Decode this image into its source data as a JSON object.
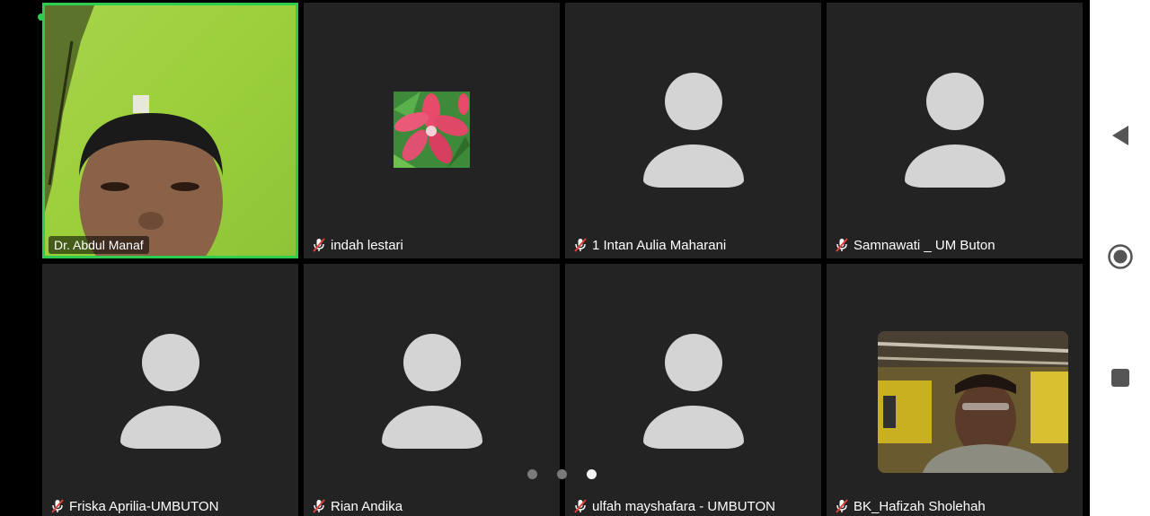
{
  "meeting": {
    "participants": [
      {
        "name": "Dr. Abdul Manaf",
        "muted": false,
        "video": true,
        "active_speaker": true
      },
      {
        "name": "indah lestari",
        "muted": true,
        "video": false,
        "avatar": "flower-image"
      },
      {
        "name": "1 Intan Aulia Maharani",
        "muted": true,
        "video": false
      },
      {
        "name": "Samnawati _ UM Buton",
        "muted": true,
        "video": false
      },
      {
        "name": "Friska Aprilia-UMBUTON",
        "muted": true,
        "video": false
      },
      {
        "name": "Rian Andika",
        "muted": true,
        "video": false
      },
      {
        "name": "ulfah mayshafara - UMBUTON",
        "muted": true,
        "video": false
      },
      {
        "name": "BK_Hafizah Sholehah",
        "muted": true,
        "video": false,
        "self_view": true
      }
    ],
    "pager": {
      "total_pages": 3,
      "current_page": 3
    }
  },
  "system_nav": {
    "back_icon": "triangle-back-icon",
    "home_icon": "circle-home-icon",
    "recents_icon": "square-recents-icon"
  },
  "colors": {
    "active_border": "#2ecc4f",
    "tile_bg": "#232323",
    "mute_red": "#e0403a"
  }
}
